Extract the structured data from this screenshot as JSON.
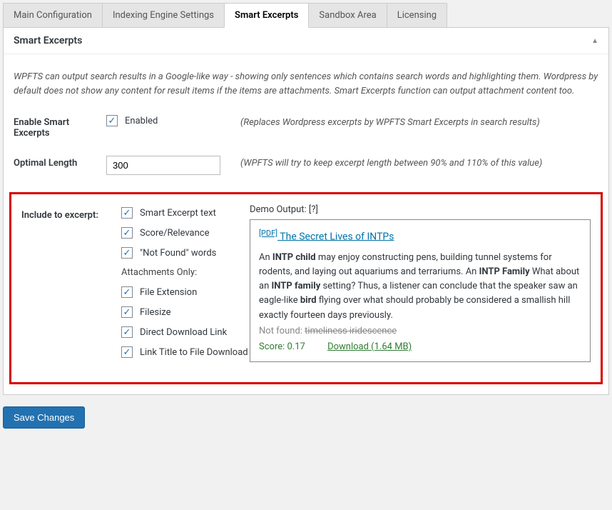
{
  "tabs": {
    "main": "Main Configuration",
    "indexing": "Indexing Engine Settings",
    "smart": "Smart Excerpts",
    "sandbox": "Sandbox Area",
    "licensing": "Licensing"
  },
  "panel": {
    "title": "Smart Excerpts",
    "intro": "WPFTS can output search results in a Google-like way - showing only sentences which contains search words and highlighting them. Wordpress by default does not show any content for result items if the items are attachments. Smart Excerpts function can output attachment content too."
  },
  "enable": {
    "label": "Enable Smart Excerpts",
    "checkbox": "Enabled",
    "note": "(Replaces Wordpress excerpts by WPFTS Smart Excerpts in search results)"
  },
  "length": {
    "label": "Optimal Length",
    "value": "300",
    "note": "(WPFTS will try to keep excerpt length between 90% and 110% of this value)"
  },
  "include": {
    "label": "Include to excerpt:",
    "opts": {
      "smart_text": "Smart Excerpt text",
      "score": "Score/Relevance",
      "notfound": "\"Not Found\" words",
      "subhead": "Attachments Only:",
      "file_ext": "File Extension",
      "filesize": "Filesize",
      "ddl": "Direct Download Link",
      "linktitle": "Link Title to File Download"
    }
  },
  "demo": {
    "label": "Demo Output: [?]",
    "pdf_tag": "[PDF]",
    "title": " The Secret Lives of INTPs",
    "t1": "An ",
    "b1": "INTP child",
    "t2": " may enjoy constructing pens, building tunnel systems for rodents, and laying out aquariums and terrariums. An ",
    "b2": "INTP Family",
    "t3": " What about an ",
    "b3": "INTP family",
    "t4": " setting? Thus, a listener can conclude that the speaker saw an eagle-like ",
    "b4": "bird",
    "t5": " flying over what should probably be considered a smallish hill exactly fourteen days previously.",
    "nf_label": "Not found: ",
    "nf_words": "timeliness iridescence",
    "score": "Score: 0.17",
    "download": "Download (1.64 MB)"
  },
  "save": "Save Changes"
}
